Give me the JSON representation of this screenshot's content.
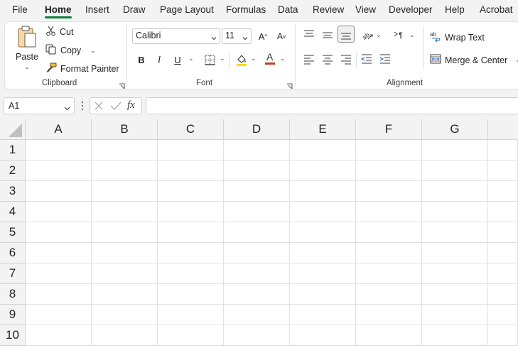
{
  "menu": {
    "tabs": [
      "File",
      "Home",
      "Insert",
      "Draw",
      "Page Layout",
      "Formulas",
      "Data",
      "Review",
      "View",
      "Developer",
      "Help",
      "Acrobat"
    ],
    "active": "Home"
  },
  "ribbon": {
    "clipboard": {
      "paste_label": "Paste",
      "cut_label": "Cut",
      "copy_label": "Copy",
      "format_painter_label": "Format Painter",
      "group_label": "Clipboard"
    },
    "font": {
      "font_name": "Calibri",
      "font_size": "11",
      "bold_label": "B",
      "italic_label": "I",
      "underline_label": "U",
      "group_label": "Font"
    },
    "alignment": {
      "wrap_text_label": "Wrap Text",
      "merge_center_label": "Merge & Center",
      "group_label": "Alignment"
    }
  },
  "formula_bar": {
    "name_box": "A1",
    "fx_label": "fx",
    "formula": ""
  },
  "sheet": {
    "columns": [
      "A",
      "B",
      "C",
      "D",
      "E",
      "F",
      "G"
    ],
    "rows": [
      "1",
      "2",
      "3",
      "4",
      "5",
      "6",
      "7",
      "8",
      "9",
      "10"
    ],
    "selected_cell": "A1"
  },
  "colors": {
    "accent": "#107c41",
    "font_color": "#c43e1c",
    "highlight": "#ffd800"
  }
}
